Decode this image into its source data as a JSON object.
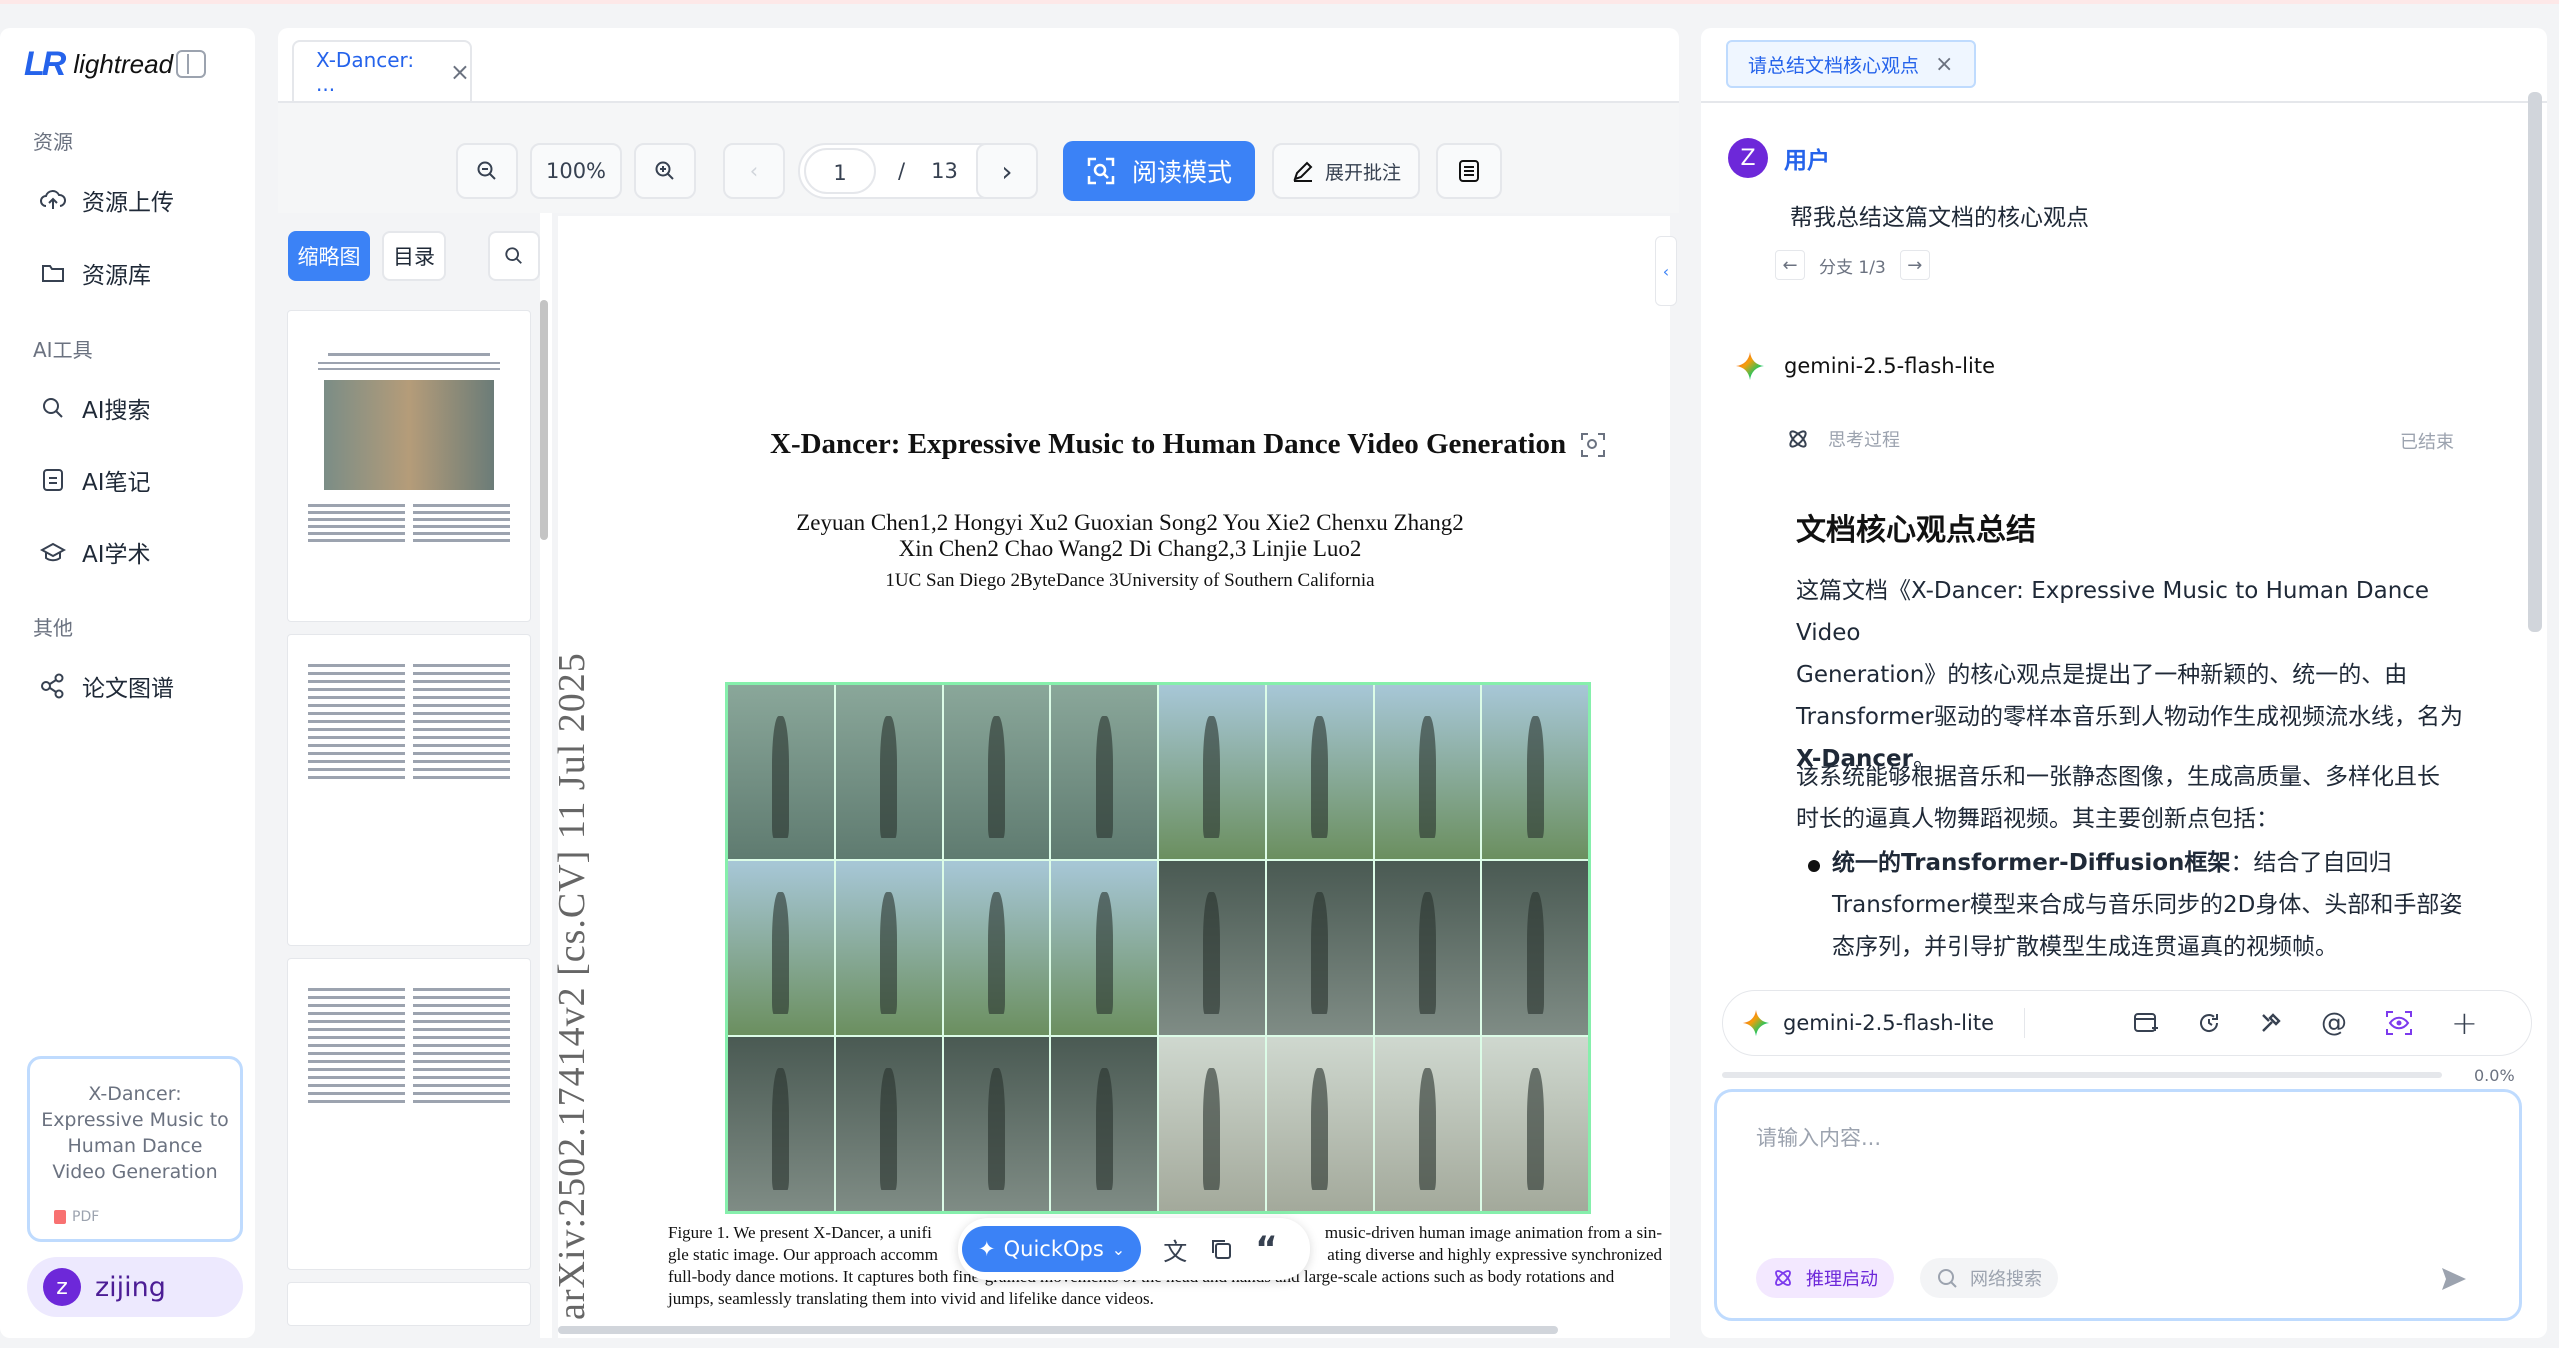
{
  "app": {
    "brand_mark": "LR",
    "brand_name": "lightread"
  },
  "sidebar": {
    "sections": [
      {
        "title": "资源",
        "items": [
          {
            "label": "资源上传",
            "icon": "upload-cloud-icon"
          },
          {
            "label": "资源库",
            "icon": "folder-icon"
          }
        ]
      },
      {
        "title": "AI工具",
        "items": [
          {
            "label": "AI搜索",
            "icon": "search-icon"
          },
          {
            "label": "AI笔记",
            "icon": "note-icon"
          },
          {
            "label": "AI学术",
            "icon": "graduation-cap-icon"
          }
        ]
      },
      {
        "title": "其他",
        "items": [
          {
            "label": "论文图谱",
            "icon": "graph-icon"
          }
        ]
      }
    ],
    "doc_card": {
      "title": "X-Dancer: Expressive Music to Human Dance Video Generation",
      "type": "PDF"
    },
    "user": {
      "initial": "z",
      "name": "zijing"
    }
  },
  "viewer": {
    "tab_label": "X-Dancer: ...",
    "toolbar": {
      "zoom": "100%",
      "page": "1",
      "page_sep": "/",
      "total_pages": "13",
      "read_mode": "阅读模式",
      "annotate": "展开批注"
    },
    "panel_tabs": {
      "thumbnails": "缩略图",
      "toc": "目录"
    },
    "paper": {
      "title": "X-Dancer: Expressive Music to Human Dance Video Generation",
      "authors_line1": "Zeyuan Chen1,2     Hongyi Xu2     Guoxian Song2     You Xie2     Chenxu Zhang2",
      "authors_line2": "Xin Chen2     Chao Wang2     Di Chang2,3     Linjie Luo2",
      "affiliations": "1UC San Diego    2ByteDance    3University of Southern California",
      "arxiv": "arXiv:2502.17414v2  [cs.CV]  11 Jul 2025",
      "caption_1": "Figure 1.  We present X-Dancer, a unifi",
      "caption_1b": "music-driven human image animation from a sin-",
      "caption_2": "gle static image. Our approach accomm",
      "caption_2b": "ating diverse and highly expressive synchronized",
      "caption_3": "full-body dance motions. It captures both fine-grained movements of the head and hands and large-scale actions such as body rotations and",
      "caption_4": "jumps, seamlessly translating them into vivid and lifelike dance videos."
    },
    "quickops": {
      "label": "QuickOps"
    }
  },
  "chat": {
    "tab_label": "请总结文档核心观点",
    "user": {
      "initial": "Z",
      "name": "用户",
      "message": "帮我总结这篇文档的核心观点",
      "branch": "分支 1/3"
    },
    "model": {
      "name": "gemini-2.5-flash-lite",
      "thinking": "思考过程",
      "thinking_status": "已结束"
    },
    "answer": {
      "heading": "文档核心观点总结",
      "p1_l1": "这篇文档《X-Dancer: Expressive Music to Human Dance Video",
      "p1_l2": "Generation》的核心观点是提出了一种新颖的、统一的、由",
      "p1_l3": "Transformer驱动的零样本音乐到人物动作生成视频流水线，名为",
      "p1_l4_bold": "X-Dancer",
      "p1_l4_end": "。",
      "p2_l1": "该系统能够根据音乐和一张静态图像，生成高质量、多样化且长",
      "p2_l2": "时长的逼真人物舞蹈视频。其主要创新点包括：",
      "li1_bold": "统一的Transformer-Diffusion框架",
      "li1_l1": "：结合了自回归",
      "li1_l2": "Transformer模型来合成与音乐同步的2D身体、头部和手部姿",
      "li1_l3": "态序列，并引导扩散模型生成连贯逼真的视频帧。"
    },
    "composer": {
      "model": "gemini-2.5-flash-lite",
      "progress": "0.0%",
      "placeholder": "请输入内容...",
      "reasoning": "推理启动",
      "web_search": "网络搜索"
    }
  },
  "colors": {
    "accent": "#3b82f6",
    "purple": "#6d28d9"
  }
}
